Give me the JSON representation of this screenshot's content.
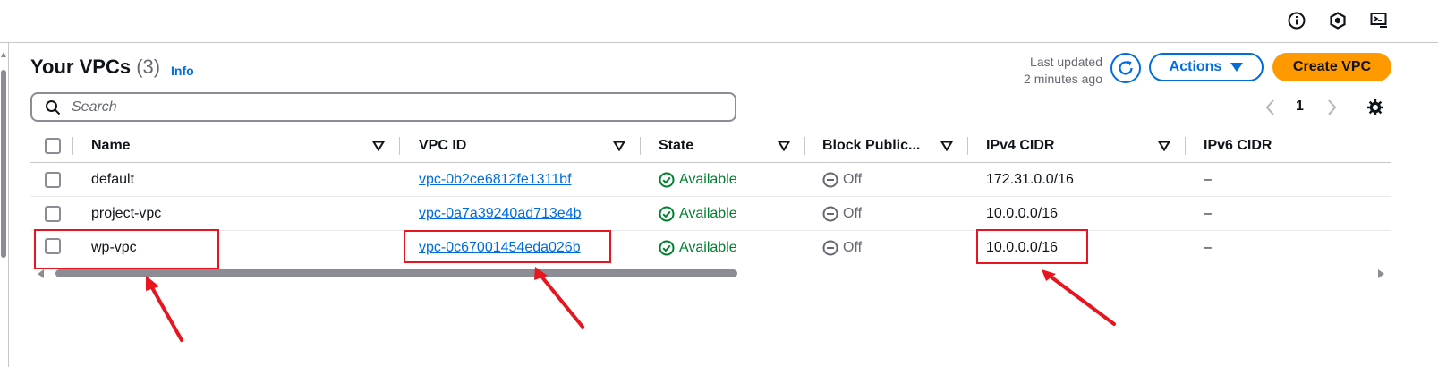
{
  "header": {
    "title": "Your VPCs",
    "count": "(3)",
    "info_label": "Info",
    "last_updated_line1": "Last updated",
    "last_updated_line2": "2 minutes ago",
    "actions_label": "Actions",
    "create_label": "Create VPC"
  },
  "topbar": {
    "icons": [
      "info-circle-icon",
      "hexagon-settings-icon",
      "cloudshell-icon"
    ]
  },
  "search": {
    "placeholder": "Search",
    "value": ""
  },
  "pagination": {
    "current_page": "1"
  },
  "table": {
    "columns": [
      "Name",
      "VPC ID",
      "State",
      "Block Public...",
      "IPv4 CIDR",
      "IPv6 CIDR"
    ],
    "rows": [
      {
        "name": "default",
        "vpc_id": "vpc-0b2ce6812fe1311bf",
        "state": "Available",
        "block_public": "Off",
        "ipv4": "172.31.0.0/16",
        "ipv6": "–"
      },
      {
        "name": "project-vpc",
        "vpc_id": "vpc-0a7a39240ad713e4b",
        "state": "Available",
        "block_public": "Off",
        "ipv4": "10.0.0.0/16",
        "ipv6": "–"
      },
      {
        "name": "wp-vpc",
        "vpc_id": "vpc-0c67001454eda026b",
        "state": "Available",
        "block_public": "Off",
        "ipv4": "10.0.0.0/16",
        "ipv6": "–"
      }
    ]
  },
  "colors": {
    "link": "#006ce0",
    "primary_button": "#ff9900",
    "success": "#00802f",
    "annotation": "#e8151f"
  }
}
